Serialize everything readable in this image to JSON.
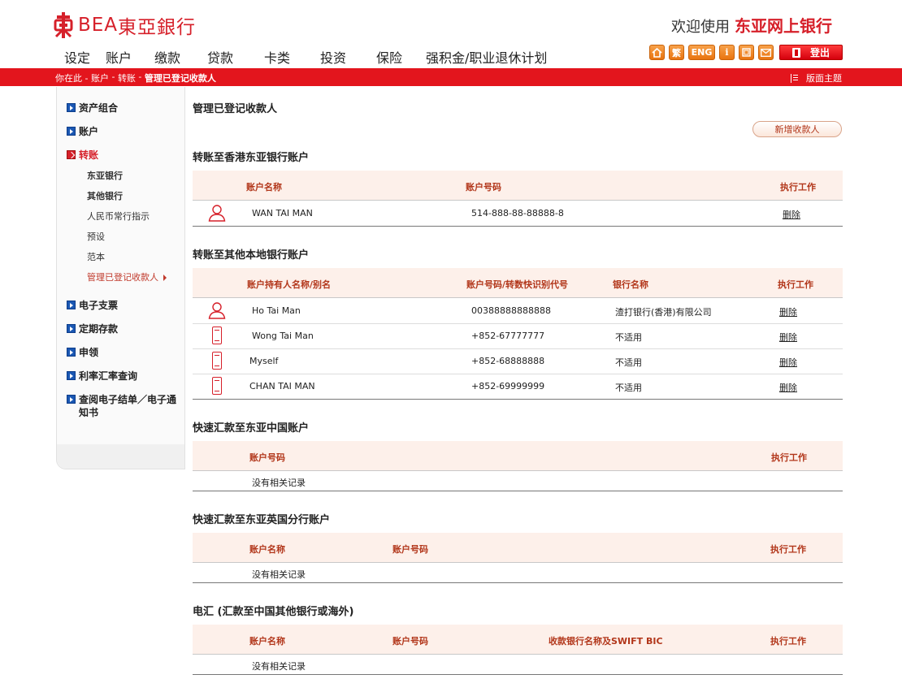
{
  "header": {
    "logo_en": "BEA",
    "logo_cn": "東亞銀行",
    "welcome_text": "欢迎使用",
    "brand_text": "东亚网上银行"
  },
  "mainnav": [
    {
      "label": "设定"
    },
    {
      "label": "账户"
    },
    {
      "label": "缴款"
    },
    {
      "label": "贷款"
    },
    {
      "label": "卡类"
    },
    {
      "label": "投资"
    },
    {
      "label": "保险"
    },
    {
      "label": "强积金/职业退休计划"
    }
  ],
  "toolbar": {
    "home_icon": "home-icon",
    "traditional_label": "繁",
    "eng_label": "ENG",
    "info_label": "i",
    "print_icon": "print-icon",
    "mail_icon": "mail-icon",
    "logout_label": "登出"
  },
  "breadcrumb": {
    "prefix": "你在此 - ",
    "item1": "账户",
    "sep1": " - ",
    "item2": "转账",
    "sep2": " - ",
    "current": "管理已登记收款人",
    "theme_label": "版面主题"
  },
  "sidebar": {
    "items": [
      {
        "label": "资产组合"
      },
      {
        "label": "账户"
      },
      {
        "label": "转账"
      },
      {
        "label": "电子支票"
      },
      {
        "label": "定期存款"
      },
      {
        "label": "申领"
      },
      {
        "label": "利率汇率查询"
      },
      {
        "label": "查阅电子结单／电子通知书"
      }
    ],
    "subitems": [
      {
        "label": "东亚银行"
      },
      {
        "label": "其他银行"
      },
      {
        "label": "人民币常行指示"
      },
      {
        "label": "预设"
      },
      {
        "label": "范本"
      },
      {
        "label": "管理已登记收款人"
      }
    ]
  },
  "main": {
    "title": "管理已登记收款人",
    "add_button": "新增收款人",
    "sections": [
      {
        "title": "转账至香港东亚银行账户",
        "headers": [
          "账户名称",
          "账户号码",
          "执行工作"
        ],
        "rows": [
          {
            "icon": "user-icon",
            "name": "WAN TAI MAN",
            "account": "514-888-88-88888-8",
            "action": "删除"
          }
        ]
      },
      {
        "title": "转账至其他本地银行账户",
        "headers": [
          "账户持有人名称/别名",
          "账户号码/转数快识别代号",
          "银行名称",
          "执行工作"
        ],
        "rows": [
          {
            "icon": "user-icon",
            "name": "Ho Tai Man",
            "account": "00388888888888",
            "bank": "渣打银行(香港)有限公司",
            "action": "删除"
          },
          {
            "icon": "phone-icon",
            "name": "Wong Tai Man",
            "account": "+852-67777777",
            "bank": "不适用",
            "action": "删除"
          },
          {
            "icon": "phone-icon",
            "name": "Myself",
            "account": "+852-68888888",
            "bank": "不适用",
            "action": "删除"
          },
          {
            "icon": "phone-icon",
            "name": "CHAN TAI MAN",
            "account": "+852-69999999",
            "bank": "不适用",
            "action": "删除"
          }
        ]
      },
      {
        "title": "快速汇款至东亚中国账户",
        "headers": [
          "账户号码",
          "执行工作"
        ],
        "empty": "没有相关记录"
      },
      {
        "title": "快速汇款至东亚英国分行账户",
        "headers": [
          "账户名称",
          "账户号码",
          "执行工作"
        ],
        "empty": "没有相关记录"
      },
      {
        "title": "电汇 (汇款至中国其他银行或海外)",
        "headers": [
          "账户名称",
          "账户号码",
          "收款银行名称及SWIFT BIC",
          "执行工作"
        ],
        "empty": "没有相关记录"
      }
    ]
  },
  "colors": {
    "brand_red": "#e3151d",
    "header_text": "#b2361a",
    "table_header_bg": "#fdf0ea",
    "nav_square_blue": "#1a57b3",
    "toolbar_orange": "#e9740f"
  }
}
